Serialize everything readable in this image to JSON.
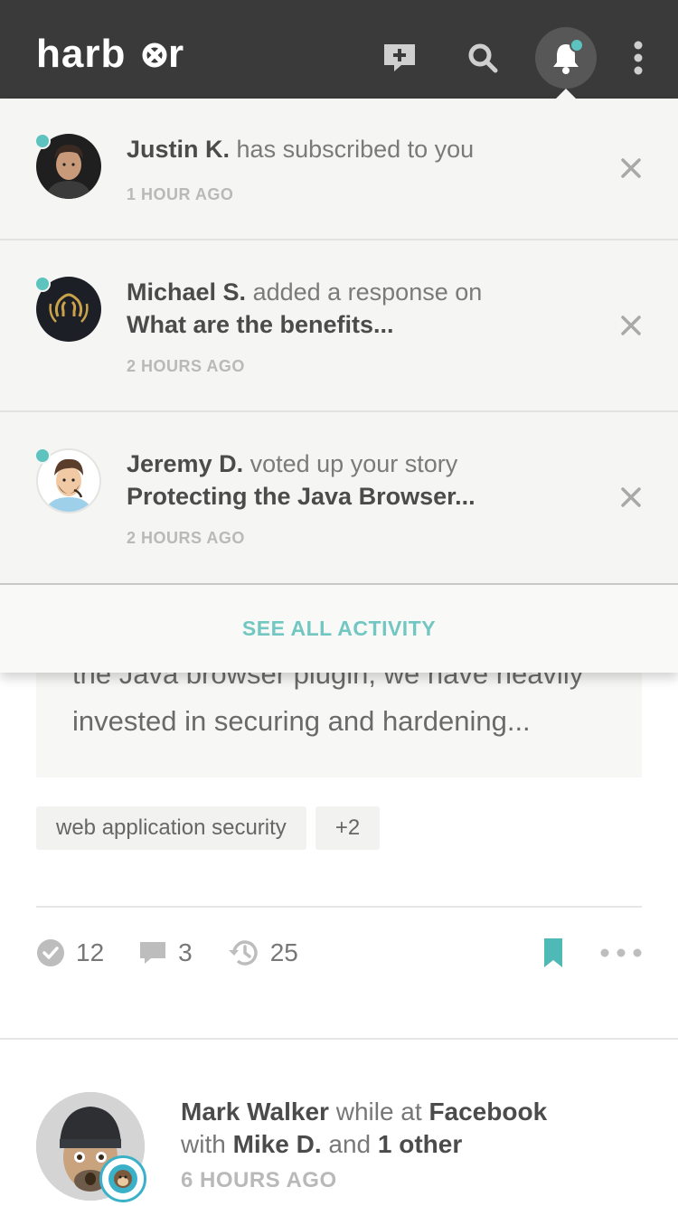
{
  "header": {
    "logo": "harbor",
    "icons": [
      "new-post-icon",
      "search-icon",
      "bell-icon",
      "more-vertical-icon"
    ]
  },
  "notifications": [
    {
      "user": "Justin K.",
      "action": "has subscribed to you",
      "object": "",
      "time": "1 HOUR AGO"
    },
    {
      "user": "Michael S.",
      "action": "added a response on",
      "object": "What are the benefits...",
      "time": "2 HOURS AGO"
    },
    {
      "user": "Jeremy D.",
      "action": "voted up your story",
      "object": "Protecting the Java Browser...",
      "time": "2 HOURS AGO"
    }
  ],
  "see_all_label": "SEE ALL ACTIVITY",
  "story": {
    "excerpt_line1": "the Java browser plugin, we have heavily",
    "excerpt_line2": "invested in securing and hardening...",
    "tags": [
      "web application security",
      "+2"
    ],
    "stats": {
      "votes": "12",
      "comments": "3",
      "history": "25"
    }
  },
  "feed_post": {
    "author": "Mark Walker",
    "while_at": "while at",
    "company": "Facebook",
    "with": "with",
    "with_user": "Mike D.",
    "and": "and",
    "others": "1 other",
    "time": "6 HOURS AGO"
  },
  "colors": {
    "header_bg": "#3a3a3a",
    "accent": "#5cc3bf",
    "dropdown_bg": "#f5f5f3"
  }
}
